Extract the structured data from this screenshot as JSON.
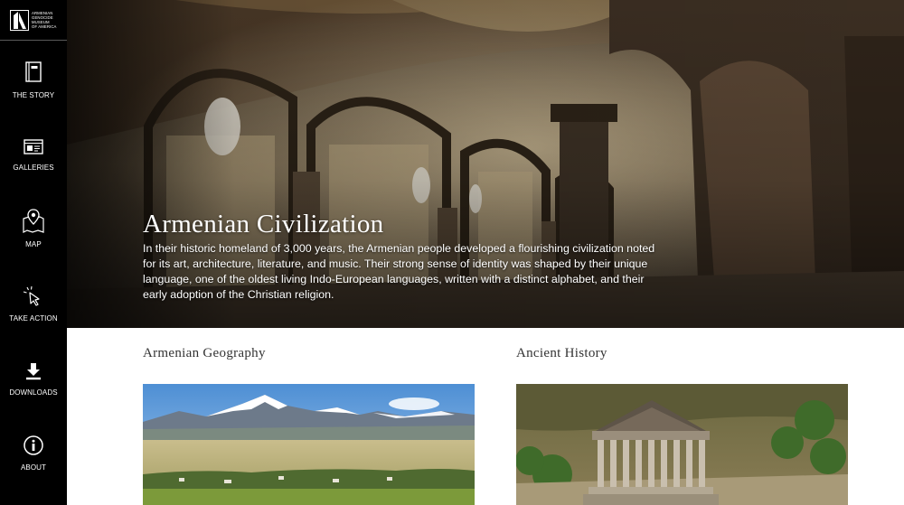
{
  "brand": {
    "logo_lines": [
      "Armenian",
      "Genocide",
      "Museum",
      "of America"
    ]
  },
  "sidebar": {
    "items": [
      {
        "label": "The Story",
        "icon": "book-icon"
      },
      {
        "label": "Galleries",
        "icon": "gallery-icon"
      },
      {
        "label": "Map",
        "icon": "map-pin-icon"
      },
      {
        "label": "Take Action",
        "icon": "cursor-click-icon"
      },
      {
        "label": "Downloads",
        "icon": "download-icon"
      },
      {
        "label": "About",
        "icon": "info-icon"
      }
    ]
  },
  "hero": {
    "title": "Armenian Civilization",
    "description": "In their historic homeland of 3,000 years, the Armenian people developed a flourishing civilization noted for its art, architecture, literature, and music. Their strong sense of identity was shaped by their unique language, one of the oldest living Indo-European languages, written with a distinct alphabet, and their early adoption of the Christian religion."
  },
  "cards": [
    {
      "title": "Armenian Geography"
    },
    {
      "title": "Ancient History"
    }
  ],
  "colors": {
    "sidebar_bg": "#000000",
    "title_text": "#333333"
  }
}
